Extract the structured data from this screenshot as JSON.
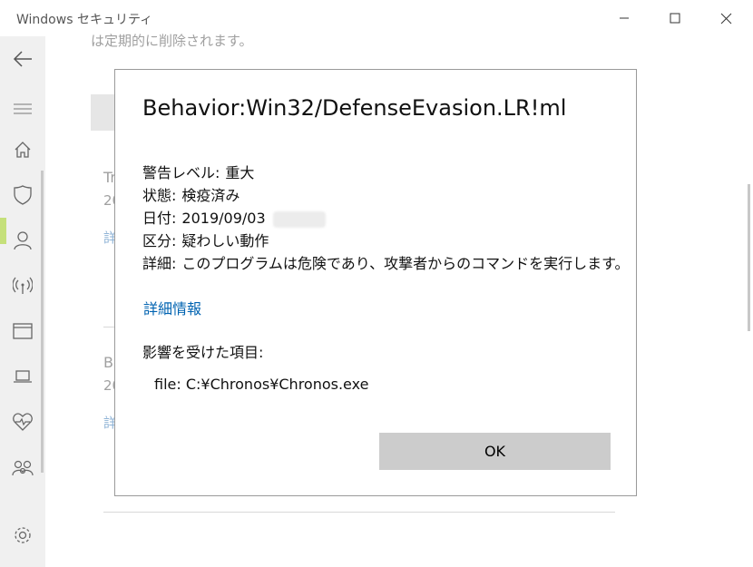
{
  "window": {
    "title": "Windows セキュリティ"
  },
  "background": {
    "top_text": "は定期的に削除されます。",
    "items": [
      {
        "name": "Tr",
        "date": "20",
        "link": "詳"
      },
      {
        "name": "Be",
        "date": "20",
        "link": "詳"
      }
    ]
  },
  "dialog": {
    "threat_name": "Behavior:Win32/DefenseEvasion.LR!ml",
    "alert_level_label": "警告レベル:",
    "alert_level_value": "重大",
    "status_label": "状態:",
    "status_value": "検疫済み",
    "date_label": "日付:",
    "date_value": "2019/09/03",
    "category_label": "区分:",
    "category_value": "疑わしい動作",
    "details_label": "詳細:",
    "details_value": "このプログラムは危険であり、攻撃者からのコマンドを実行します。",
    "more_info_link": "詳細情報",
    "affected_items_label": "影響を受けた項目:",
    "file_label": "file:",
    "file_path": "C:¥Chronos¥Chronos.exe",
    "ok_button": "OK"
  }
}
